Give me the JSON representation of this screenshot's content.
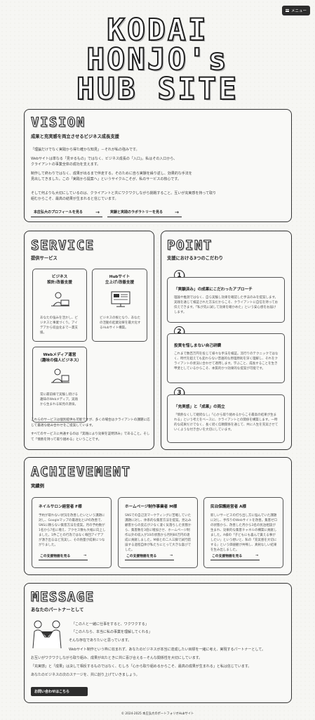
{
  "header": {
    "menu_label": "メニュー"
  },
  "hero": {
    "line1": "KODAI",
    "line2": "HONJO's",
    "line3": "HUB SITE"
  },
  "vision": {
    "title": "VISION",
    "subtitle": "成果と充実感を両立させるビジネス成長支援",
    "p1": "「理論だけでなく実践から得た確かな知見」－それが私の強みです。",
    "p2": "Webサイトは単なる「見せるもの」ではなく、ビジネス成長の「入口」。私はその入口から、クライアントの事業全体の成功を支えます。",
    "p3": "制作して終わりではなく、成果が出るまで伴走する。そのために自ら実験を繰り返し、効果的な手法を見出してきました。この「実践から提案へ」というサイクルこそが、私のサービスの核心です。",
    "p4": "そして何よりも大切にしているのは、クライアントと共にワクワクしながら挑戦すること。互いが充実感を持って取り組むからこそ、最高の結果が生まれると信じています。",
    "btn_profile": "本庄弘大のプロフィールを見る",
    "btn_lab": "実験と実践のラボラトリーを見る"
  },
  "service": {
    "title": "SERVICE",
    "subtitle": "提供サービス",
    "items": [
      {
        "title1": "ビジネス",
        "title2": "設計/改善支援",
        "desc": "あなたの強みを活かし、ビジネスと事業づくり。アイデアから収益化まで一貫支援。"
      },
      {
        "title1": "Hubサイト",
        "title2": "立上げ/改善支援",
        "desc": "ビジネスの根となり、あなたの活動の起業効果を最大化するHubサイト構築。"
      },
      {
        "title1": "Webメディア運営",
        "title2": "（趣味の個人ビジネス）",
        "desc": "常に最前線で実験し続ける趣味のWebメディア。実践から生まれる知見の源泉。"
      }
    ],
    "p1": "これらのサービスは個別提供も可能ですが、多くの場合はクライアントの課題に応じて最適な組み合わせをご提案しています。",
    "p2": "すべてのサービスに共通するのは「実践により効果を証明済み」であること。そして「情熱を持って取り組める」ということです。"
  },
  "point": {
    "title": "POINT",
    "subtitle": "支援における3つのこだわり",
    "items": [
      {
        "num": "1",
        "heading": "「実験済み」の成果にこだわったアプローチ",
        "desc": "理論や推測ではなく、自ら実験し効果を確認した手法のみを提案します。実践を通じて検証された方法だからこそ、クライアントに自信を持ってお伝えできます。「私が先に試して効果を確かめた」という安心感をお届けします。"
      },
      {
        "num": "2",
        "heading": "投資を惜しまない自己研鑽",
        "desc": "これまで数百万円を投じて様々な手法を検証。流行りのテクニックではなく、時代を超えても変わらない普遍的な原理原則を深く理解し、それをクライアントの状況に合わせて適用します。学ぶこと、成長することを生き甲斐としているからこそ、本質的かつ効果的な提案が可能です。"
      },
      {
        "num": "3",
        "heading": "「充実感」と「成果」の両立",
        "desc": "「情熱なくして継続なし」「心から取り組めるからこそ最高の結果が生まれる」という考えをベースに、クライアントとの関係を構築します。一時的な成果だけでなく、長く続く信頼関係を通じて、共に人生を充実させていくような付き合いを大切にしています。"
      }
    ]
  },
  "achievement": {
    "title": "ACHIEVEMENT",
    "subtitle": "実績例",
    "items": [
      {
        "heading": "ネイルサロン経営者 F様",
        "desc": "予約が取れない状況を改善したいという課題に対し、Googleマップの最適化とLPの改善で、SNSに頼らない集客方法を提案。月の予約数が1名から7名に増え、アクセス数も大幅に向上しました。1件ごとの行為ではなく毎回アイデアが湧き出るほど充実し、その熱量が成果につながりました。",
        "link": "この支援物語を見る"
      },
      {
        "heading": "ホームページ制作事業者 M様",
        "desc": "SNSでの自己流マーケティングに苦戦していた課題に対し、体系的な集客方法を提案。見込み顧客からの反応が少なく凄く気落ちした状態から、集客数を3倍に増加させ、ホームページ制作以外の収入が10の状態から月利80万円の達成に貢献しました。M様との二人三脚で試行錯誤する過程自体が私たちにとって大きな喜びでした。",
        "link": "この支援物語を見る"
      },
      {
        "heading": "民泊保護経営者 A様",
        "desc": "新しいサービスの打ち出し方に悩んでいた課題に対し、手作りのWebサイトを改善。集客ゼロの状態から、改善した月から3名の民泊相談が生まれ、効果的な集客チャネルの構築に貢献しました。A様の「子どもにも喜んで貰える事がしたい」という想いと、私の「充実感を大切にする」という価値観が共鳴し、真剣なしい結果を生み出しました。",
        "link": "この支援物語を見る"
      }
    ]
  },
  "message": {
    "title": "MESSAGE",
    "subtitle": "あなたのパートナーとして",
    "q1": "「この人と一緒に仕事をすると、ワクワクする」",
    "q2": "「この人なら、本当に私の事業を理解してくれる」",
    "q3": "そんな存在でありたいと思っています。",
    "p1": "Webサイト制作という枠に収まれず、あなたのビジネスが本当に達成したい目標を一緒に考え、実現するパートナーとして。",
    "p2": "お互いがワクワクしながら取り組み、成果が出たときに共に喜び合える－そんな関係性を大切にしています。",
    "p3": "「充実感」と「成果」は決して相反するものではなく、むしろ「心から取り組めるからこそ、最高の成果が生まれる」と私は信じています。",
    "p4": "あなたのビジネスの次のステージを、共に創り上げていきましょう。",
    "cta": "お問い合わせはこちら"
  },
  "footer": {
    "copyright": "© 2024-2025 本庄弘大のポートフォリオHubサイト"
  }
}
